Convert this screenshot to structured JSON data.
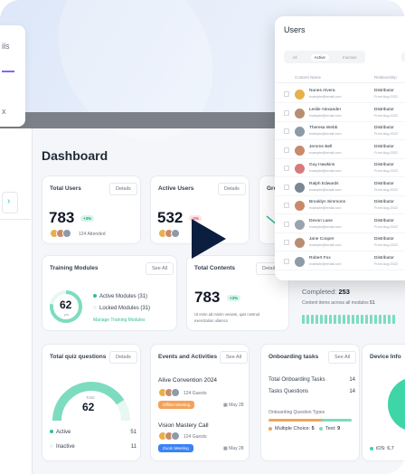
{
  "sidebar_peek": {
    "top_text": "ils",
    "bottom_text": "x",
    "tab_icon": "chevron-right-icon"
  },
  "page": {
    "title": "Dashboard"
  },
  "total_users": {
    "title": "Total Users",
    "button": "Details",
    "value": "783",
    "badge": "+3%",
    "avatars_text": "124 Attended"
  },
  "active_users": {
    "title": "Active Users",
    "button": "Details",
    "value": "532",
    "badge": "-2%"
  },
  "third_card_peek": {
    "title": "Gro"
  },
  "training_modules": {
    "title": "Training Modules",
    "button": "See All",
    "donut_value": "62",
    "donut_sub": "pts",
    "active_label": "Active Modules",
    "active_count": "(31)",
    "locked_label": "Locked Modules",
    "locked_count": "(31)",
    "link": "Manage Training Modules"
  },
  "total_contents": {
    "title": "Total Contents",
    "button": "Details",
    "value": "783",
    "badge": "+3%",
    "desc_line1": "Ut enim ad minim veniam, quis nostrud",
    "desc_line2": "exercitation ullamco"
  },
  "completed": {
    "label": "Completed:",
    "value": "253",
    "desc": "Content items across all modules",
    "desc_value": "51"
  },
  "quiz": {
    "title": "Total quiz questions",
    "button": "Details",
    "donut_label": "Total",
    "donut_value": "62",
    "active_label": "Active",
    "active_value": "51",
    "inactive_label": "Inactive",
    "inactive_value": "11",
    "progress": 0.82
  },
  "events": {
    "title": "Events and Activities",
    "button": "See All",
    "items": [
      {
        "name": "Alive Convention 2024",
        "guests": "124 Guests",
        "pill": "Offline Meeting",
        "pill_color": "#f4a259",
        "date": "May 28"
      },
      {
        "name": "Vision Mastery Call",
        "guests": "124 Guests",
        "pill": "Zoom Meeting",
        "pill_color": "#3b82f6",
        "date": "May 28"
      }
    ]
  },
  "onboarding": {
    "title": "Onboarding tasks",
    "button": "See All",
    "row1_label": "Total Onboarding Tasks",
    "row1_value": "14",
    "row2_label": "Tasks Questions",
    "row2_value": "14",
    "types_label": "Onboarding Question Types",
    "mc_label": "Multiple Choice:",
    "mc_value": "5",
    "text_label": "Text:",
    "text_value": "9"
  },
  "device": {
    "title": "Device Info",
    "ios_label": "iOS: 6,7"
  },
  "users_panel": {
    "title": "Users",
    "tabs": [
      "All",
      "Active",
      "Inactive"
    ],
    "active_tab": "Active",
    "col_name": "Content Name",
    "col_role": "Relationship",
    "rows": [
      {
        "name": "Nunes Alvera",
        "email": "example@email.com",
        "role": "Distributor",
        "date": "From Aug 2022",
        "color": "#e8b04a"
      },
      {
        "name": "Leslie Alexander",
        "email": "example@email.com",
        "role": "Distributor",
        "date": "From Aug 2022",
        "color": "#b98d73"
      },
      {
        "name": "Theresa Webb",
        "email": "example@email.com",
        "role": "Distributor",
        "date": "From Aug 2022",
        "color": "#8d9aa8"
      },
      {
        "name": "Jerome Bell",
        "email": "example@email.com",
        "role": "Distributor",
        "date": "From Aug 2022",
        "color": "#c98a6a"
      },
      {
        "name": "Guy Hawkins",
        "email": "example@email.com",
        "role": "Distributor",
        "date": "From Aug 2022",
        "color": "#d77a7a"
      },
      {
        "name": "Ralph Edwards",
        "email": "example@email.com",
        "role": "Distributor",
        "date": "From Aug 2022",
        "color": "#7a8794"
      },
      {
        "name": "Brooklyn Simmons",
        "email": "example@email.com",
        "role": "Distributor",
        "date": "From Aug 2022",
        "color": "#c98a6a"
      },
      {
        "name": "Devon Lane",
        "email": "example@email.com",
        "role": "Distributor",
        "date": "From Aug 2022",
        "color": "#9aa4ae"
      },
      {
        "name": "Jane Cooper",
        "email": "example@email.com",
        "role": "Distributor",
        "date": "From Aug 2022",
        "color": "#b98d73"
      },
      {
        "name": "Robert Fox",
        "email": "example@email.com",
        "role": "Distributor",
        "date": "From Aug 2022",
        "color": "#8d9aa8"
      }
    ]
  },
  "colors": {
    "accent": "#2fbf9b",
    "play": "#0b1e3f"
  }
}
